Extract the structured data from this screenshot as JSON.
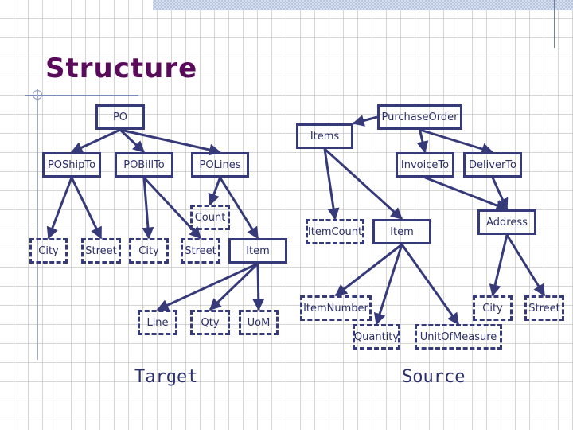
{
  "slide": {
    "title": "Structure",
    "accent_color": "#5a0a5a",
    "node_color": "#363a78"
  },
  "target": {
    "caption": "Target",
    "nodes": {
      "po": "PO",
      "poshipto": "POShipTo",
      "pobillto": "POBillTo",
      "polines": "POLines",
      "shipto_city": "City",
      "shipto_street": "Street",
      "billto_city": "City",
      "billto_street": "Street",
      "count": "Count",
      "item": "Item",
      "line": "Line",
      "qty": "Qty",
      "uom": "UoM"
    },
    "edges": [
      [
        "po",
        "poshipto"
      ],
      [
        "po",
        "pobillto"
      ],
      [
        "po",
        "polines"
      ],
      [
        "poshipto",
        "shipto_city"
      ],
      [
        "poshipto",
        "shipto_street"
      ],
      [
        "pobillto",
        "billto_city"
      ],
      [
        "pobillto",
        "billto_street"
      ],
      [
        "polines",
        "count"
      ],
      [
        "polines",
        "item"
      ],
      [
        "item",
        "line"
      ],
      [
        "item",
        "qty"
      ],
      [
        "item",
        "uom"
      ]
    ]
  },
  "source": {
    "caption": "Source",
    "nodes": {
      "purchaseorder": "PurchaseOrder",
      "items": "Items",
      "invoiceto": "InvoiceTo",
      "deliverto": "DeliverTo",
      "itemcount": "ItemCount",
      "item": "Item",
      "address": "Address",
      "itemnumber": "ItemNumber",
      "quantity": "Quantity",
      "unitofmeasure": "UnitOfMeasure",
      "city": "City",
      "street": "Street"
    },
    "edges": [
      [
        "purchaseorder",
        "items"
      ],
      [
        "purchaseorder",
        "invoiceto"
      ],
      [
        "purchaseorder",
        "deliverto"
      ],
      [
        "items",
        "itemcount"
      ],
      [
        "items",
        "item"
      ],
      [
        "invoiceto",
        "address"
      ],
      [
        "deliverto",
        "address"
      ],
      [
        "item",
        "itemnumber"
      ],
      [
        "item",
        "quantity"
      ],
      [
        "item",
        "unitofmeasure"
      ],
      [
        "address",
        "city"
      ],
      [
        "address",
        "street"
      ]
    ]
  }
}
